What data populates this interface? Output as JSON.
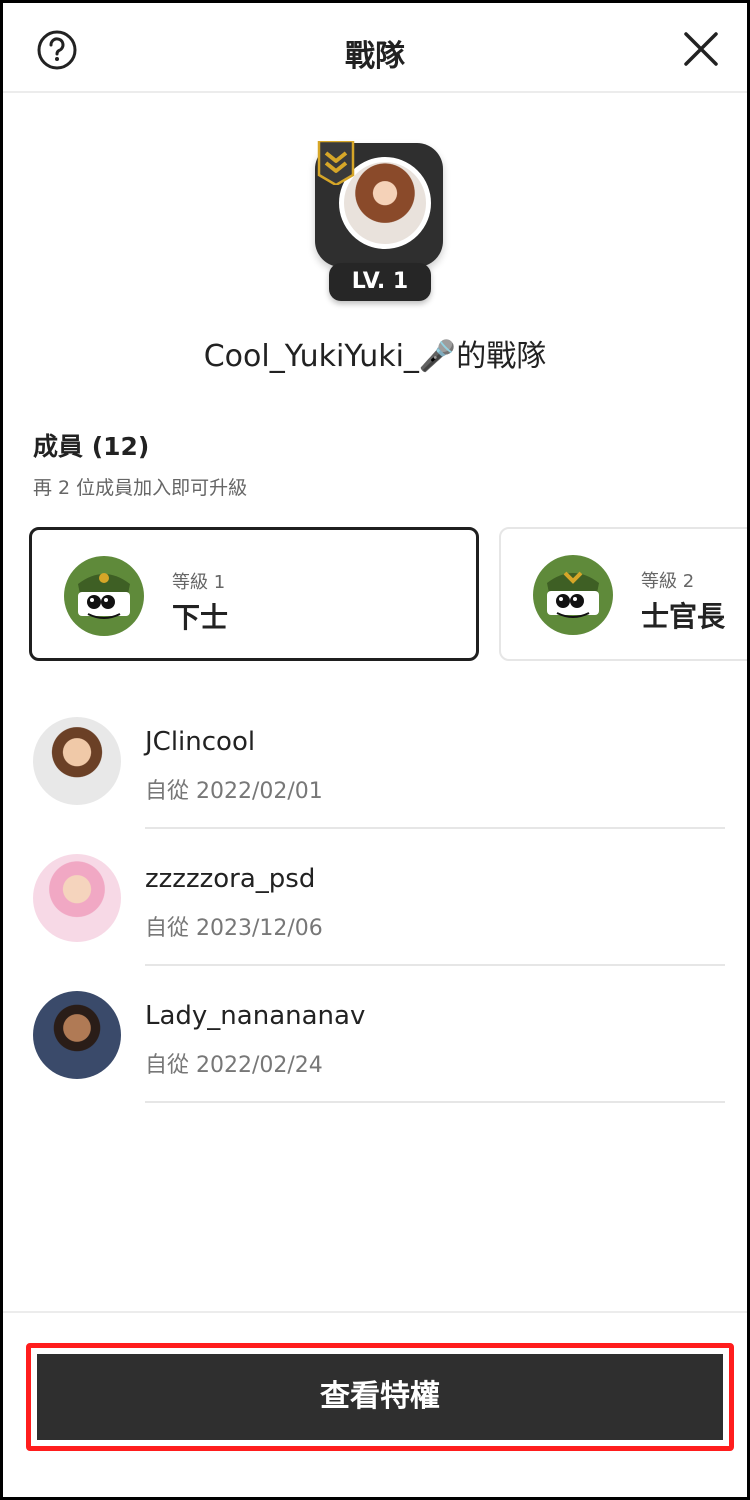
{
  "header": {
    "title": "戰隊",
    "help_icon": "help-circle-icon",
    "close_icon": "close-icon"
  },
  "team": {
    "level_badge": "LV. 1",
    "name": "Cool_YukiYuki_🎤的戰隊"
  },
  "members_section": {
    "title": "成員 (12)",
    "subtitle": "再 2 位成員加入即可升級"
  },
  "ranks": [
    {
      "level": "等級 1",
      "name": "下士",
      "selected": true
    },
    {
      "level": "等級 2",
      "name": "士官長",
      "selected": false
    }
  ],
  "members": [
    {
      "name": "JClincool",
      "since": "自從 2022/02/01"
    },
    {
      "name": "zzzzzora_psd",
      "since": "自從 2023/12/06"
    },
    {
      "name": "Lady_nanananav",
      "since": "自從 2022/02/24"
    }
  ],
  "footer": {
    "cta_label": "查看特權"
  },
  "colors": {
    "cta_background": "#2f2f2f",
    "highlight_outline": "#ff1d1d",
    "rank_badge_green": "#5f8a3a",
    "ribbon_gold": "#d6a628"
  }
}
